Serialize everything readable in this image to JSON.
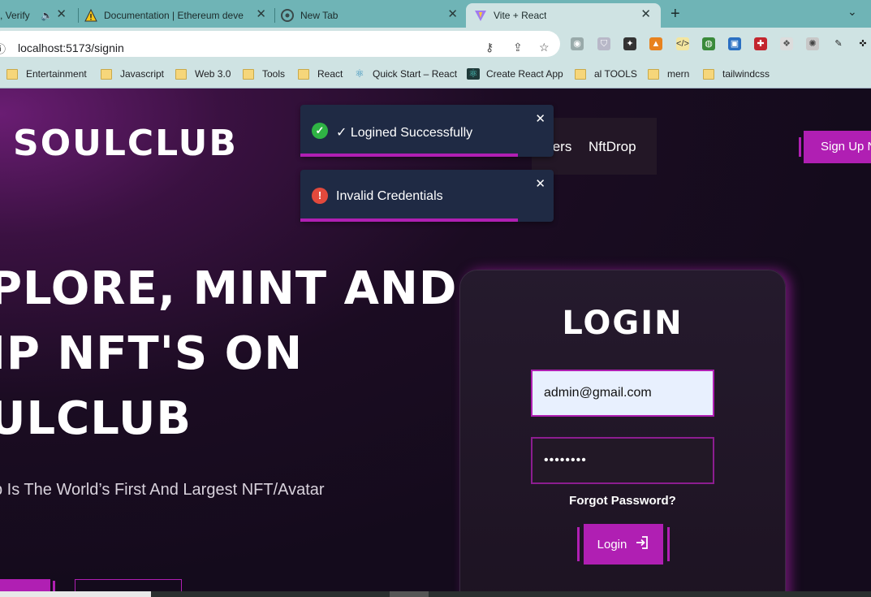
{
  "browser": {
    "tabs": [
      {
        "title": ", Verify",
        "active": false
      },
      {
        "title": "Documentation | Ethereum deve",
        "active": false
      },
      {
        "title": "New Tab",
        "active": false
      },
      {
        "title": "Vite + React",
        "active": true
      }
    ],
    "new_tab_symbol": "+",
    "url": "localhost:5173/signin",
    "bookmarks": [
      {
        "label": "Entertainment",
        "icon": "folder-icon"
      },
      {
        "label": "Javascript",
        "icon": "folder-icon"
      },
      {
        "label": "Web 3.0",
        "icon": "folder-icon"
      },
      {
        "label": "Tools",
        "icon": "folder-icon"
      },
      {
        "label": "React",
        "icon": "folder-icon"
      },
      {
        "label": "Quick Start – React",
        "icon": "react-icon"
      },
      {
        "label": "Create React App",
        "icon": "cra-icon"
      },
      {
        "label": "al TOOLS",
        "icon": "folder-icon"
      },
      {
        "label": "mern",
        "icon": "folder-icon"
      },
      {
        "label": "tailwindcss",
        "icon": "folder-icon"
      }
    ]
  },
  "site": {
    "brand": "SOULCLUB",
    "nav": [
      "ters",
      "NftDrop"
    ],
    "signup_label": "Sign Up N",
    "hero": {
      "line1": "PLORE, MINT AND",
      "line2": "IP NFT'S ON",
      "line3": "ULCLUB",
      "subtitle": "b Is The World’s First And Largest NFT/Avatar"
    }
  },
  "login": {
    "title": "LOGIN",
    "email_value": "admin@gmail.com",
    "password_value": "••••••••",
    "forgot_label": "Forgot Password?",
    "button_label": "Login"
  },
  "toasts": [
    {
      "type": "success",
      "message": "✓ Logined Successfully",
      "progress": 0.86
    },
    {
      "type": "error",
      "message": "Invalid Credentials",
      "progress": 0.86
    }
  ],
  "colors": {
    "accent": "#b01fb3",
    "tab_bar": "#6fb4b6",
    "toolbar": "#cfe3e3",
    "toast_bg": "#1f2a44",
    "success": "#2fb344",
    "error": "#e2493c"
  }
}
